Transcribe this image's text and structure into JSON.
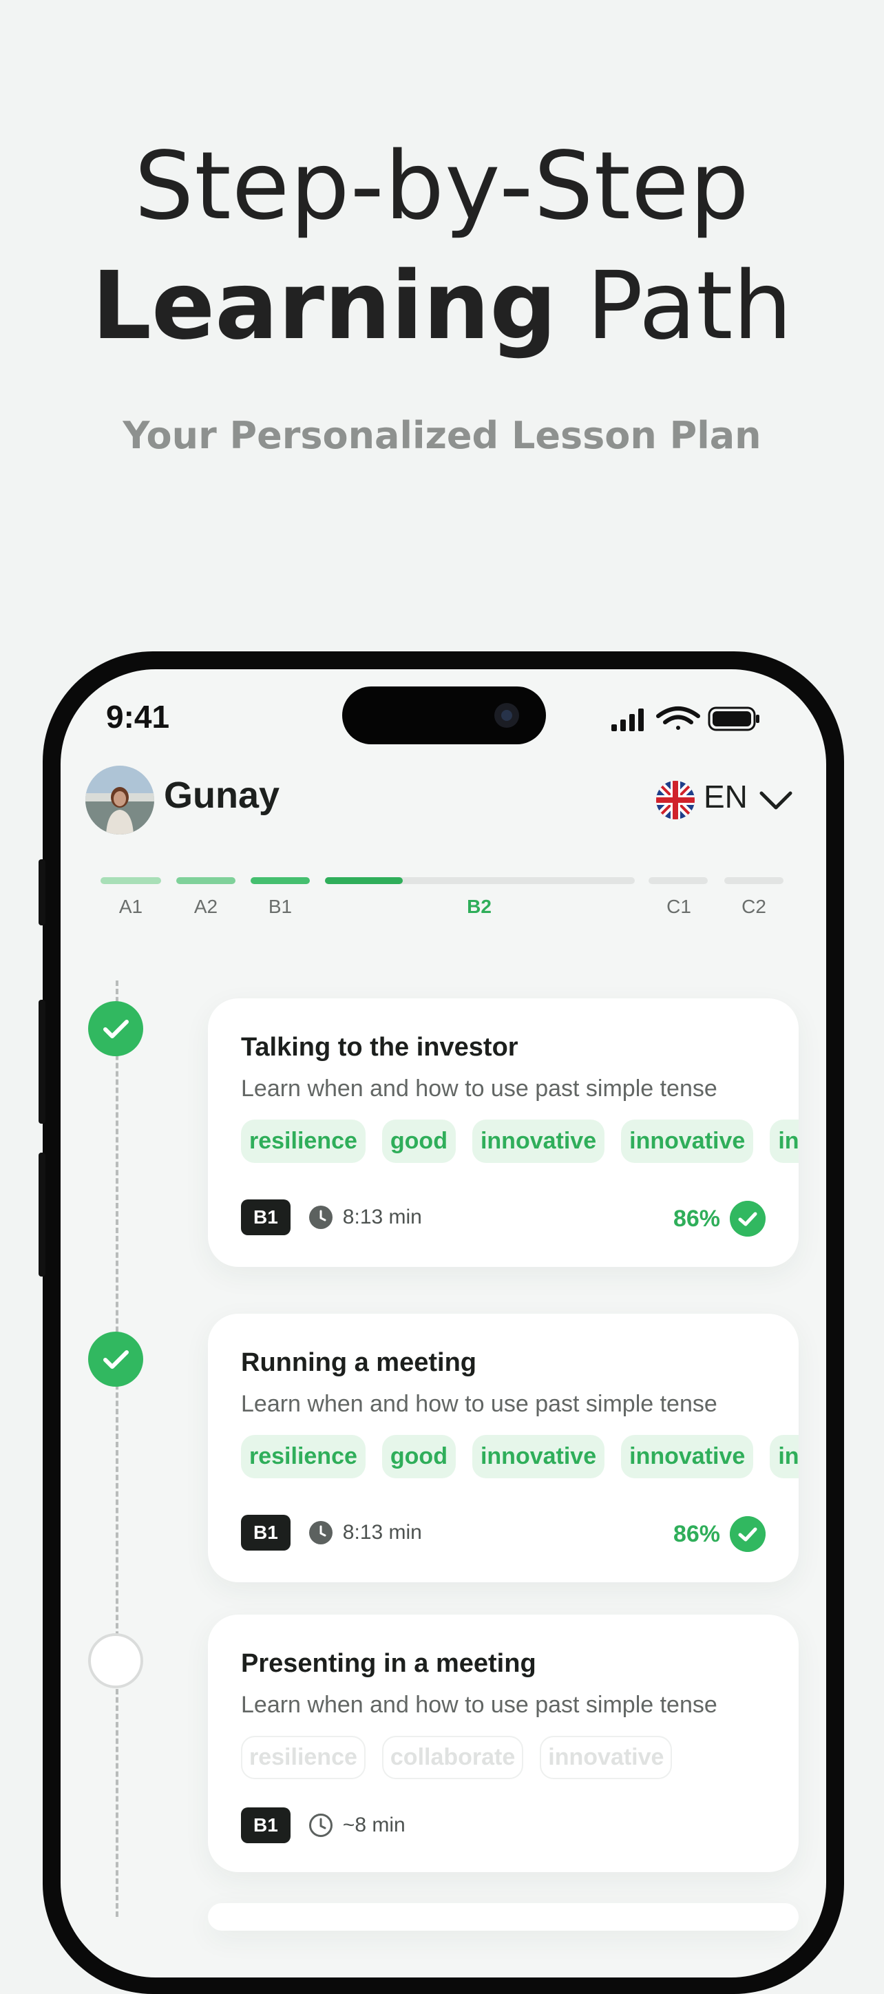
{
  "hero": {
    "line1": "Step-by-Step",
    "line2_bold": "Learning",
    "line2_rest": " Path",
    "subtitle": "Your Personalized Lesson Plan"
  },
  "status_bar": {
    "time": "9:41"
  },
  "header": {
    "username": "Gunay",
    "language_code": "EN",
    "icons": [
      "avatar",
      "uk-flag-icon",
      "chevron-down-icon"
    ]
  },
  "levels": [
    {
      "label": "A1",
      "color": "#a8dfb7"
    },
    {
      "label": "A2",
      "color": "#7fd19a"
    },
    {
      "label": "B1",
      "color": "#45bf6f"
    },
    {
      "label": "B2",
      "color": "#2fae5a",
      "active": true,
      "progress": 0.25
    },
    {
      "label": "C1",
      "color": "#e2e4e3"
    },
    {
      "label": "C2",
      "color": "#e2e4e3"
    }
  ],
  "lessons": [
    {
      "title": "Talking to the investor",
      "subtitle": "Learn when and how to use past simple tense",
      "tags": [
        "resilience",
        "good",
        "innovative",
        "innovative",
        "innovative"
      ],
      "level": "B1",
      "duration": "8:13 min",
      "score": "86%",
      "status": "completed"
    },
    {
      "title": "Running a meeting",
      "subtitle": "Learn when and how to use past simple tense",
      "tags": [
        "resilience",
        "good",
        "innovative",
        "innovative",
        "innovative"
      ],
      "level": "B1",
      "duration": "8:13 min",
      "score": "86%",
      "status": "completed"
    },
    {
      "title": "Presenting in a meeting",
      "subtitle": "Learn when and how to use past simple tense",
      "tags": [
        "resilience",
        "collaborate",
        "innovative"
      ],
      "level": "B1",
      "duration": "~8 min",
      "status": "locked"
    }
  ],
  "colors": {
    "accent": "#31b860",
    "accent_text": "#2fae5a",
    "tag_bg": "#e6f6ea",
    "background": "#f2f4f3"
  }
}
